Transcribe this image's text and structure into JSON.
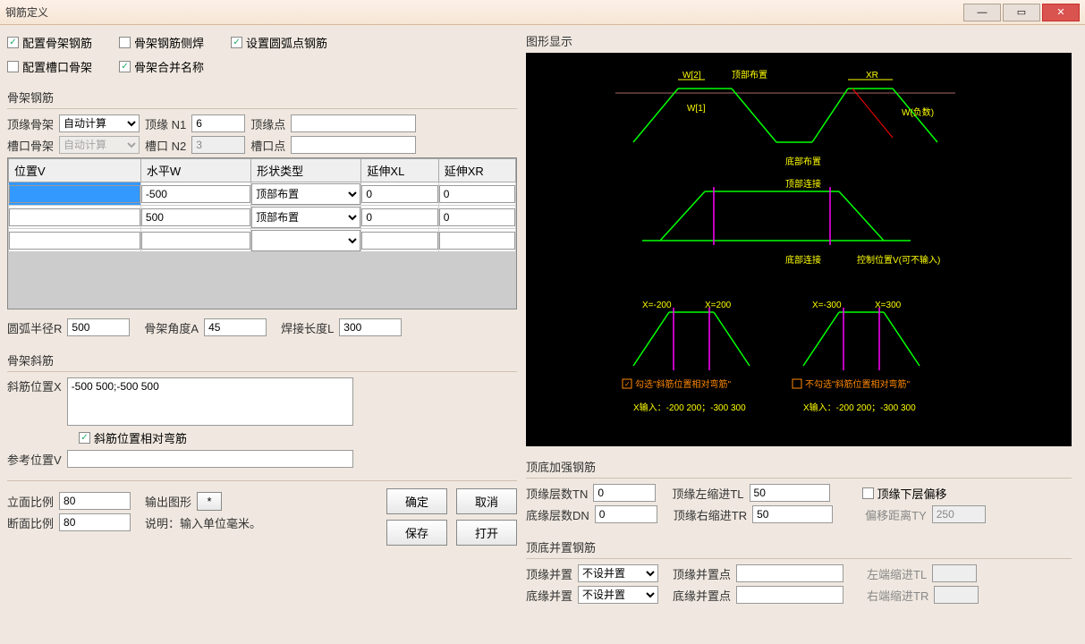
{
  "window": {
    "title": "钢筋定义"
  },
  "chk": {
    "config_frame": "配置骨架钢筋",
    "frame_side_weld": "骨架钢筋侧焊",
    "set_arc_point": "设置圆弧点钢筋",
    "config_slot": "配置槽口骨架",
    "frame_merge_name": "骨架合并名称"
  },
  "frame_group": {
    "title": "骨架钢筋",
    "top_frame_lbl": "顶缘骨架",
    "top_frame_val": "自动计算",
    "top_n1_lbl": "顶缘 N1",
    "top_n1_val": "6",
    "top_point_lbl": "顶缘点",
    "top_point_val": "",
    "slot_frame_lbl": "槽口骨架",
    "slot_frame_val": "自动计算",
    "slot_n2_lbl": "槽口 N2",
    "slot_n2_val": "3",
    "slot_point_lbl": "槽口点",
    "slot_point_val": ""
  },
  "table": {
    "h1": "位置V",
    "h2": "水平W",
    "h3": "形状类型",
    "h4": "延伸XL",
    "h5": "延伸XR",
    "rows": [
      {
        "v": "",
        "w": "-500",
        "shape": "顶部布置",
        "xl": "0",
        "xr": "0"
      },
      {
        "v": "",
        "w": "500",
        "shape": "顶部布置",
        "xl": "0",
        "xr": "0"
      },
      {
        "v": "",
        "w": "",
        "shape": "",
        "xl": "",
        "xr": ""
      }
    ]
  },
  "params": {
    "arc_r_lbl": "圆弧半径R",
    "arc_r_val": "500",
    "angle_a_lbl": "骨架角度A",
    "angle_a_val": "45",
    "weld_l_lbl": "焊接长度L",
    "weld_l_val": "300"
  },
  "diag_frame": {
    "title": "骨架斜筋",
    "x_lbl": "斜筋位置X",
    "x_val": "-500 500;-500 500",
    "rel_chk": "斜筋位置相对弯筋",
    "ref_v_lbl": "参考位置V",
    "ref_v_val": ""
  },
  "ratio": {
    "elev_lbl": "立面比例",
    "elev_val": "80",
    "sect_lbl": "断面比例",
    "sect_val": "80",
    "out_lbl": "输出图形",
    "out_btn": "*",
    "note_lbl": "说明：输入单位毫米。"
  },
  "btns": {
    "ok": "确定",
    "cancel": "取消",
    "save": "保存",
    "open": "打开"
  },
  "diagram_title": "图形显示",
  "diagram_labels": {
    "w2": "W[2]",
    "top_layout": "顶部布置",
    "XR": "XR",
    "w_neg": "W(负数)",
    "w1": "W[1]",
    "bot_layout": "底部布置",
    "top_conn": "顶部连接",
    "bot_conn": "底部连接",
    "ctrl_v": "控制位置V(可不输入)",
    "x_m200": "X=-200",
    "x_200": "X=200",
    "x_m300": "X=-300",
    "x_300": "X=300",
    "chk_rel": "勾选\"斜筋位置相对弯筋\"",
    "unchk_rel": "不勾选\"斜筋位置相对弯筋\"",
    "xin1": "X输入：-200 200；-300 300",
    "xin2": "X输入：-200 200；-300 300"
  },
  "reinforce": {
    "title": "顶底加强钢筋",
    "tn_lbl": "顶缘层数TN",
    "tn_val": "0",
    "tl_lbl": "顶缘左缩进TL",
    "tl_val": "50",
    "dn_lbl": "底缘层数DN",
    "dn_val": "0",
    "tr_lbl": "顶缘右缩进TR",
    "tr_val": "50",
    "offset_chk": "顶缘下层偏移",
    "ty_lbl": "偏移距离TY",
    "ty_val": "250"
  },
  "parallel": {
    "title": "顶底并置钢筋",
    "top_lbl": "顶缘并置",
    "top_val": "不设并置",
    "top_pt_lbl": "顶缘并置点",
    "top_pt_val": "",
    "bot_lbl": "底缘并置",
    "bot_val": "不设并置",
    "bot_pt_lbl": "底缘并置点",
    "bot_pt_val": "",
    "left_tl_lbl": "左端缩进TL",
    "left_tl_val": "",
    "right_tr_lbl": "右端缩进TR",
    "right_tr_val": ""
  }
}
